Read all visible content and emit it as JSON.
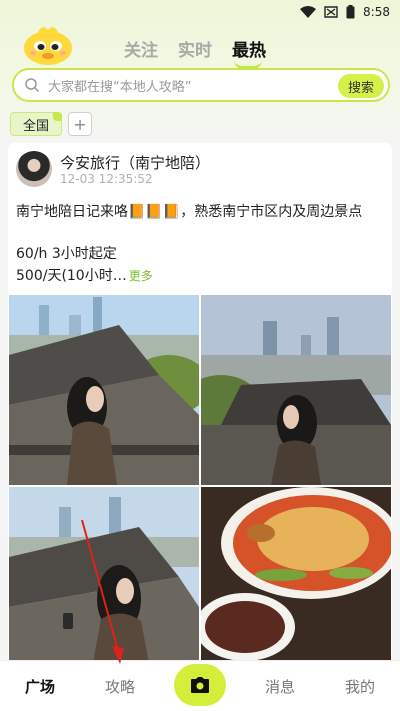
{
  "status_bar": {
    "time": "8:58",
    "icons": [
      "wifi-icon",
      "signal-icon",
      "battery-icon"
    ]
  },
  "header": {
    "tabs": [
      {
        "label": "关注",
        "active": false
      },
      {
        "label": "实时",
        "active": false
      },
      {
        "label": "最热",
        "active": true
      }
    ]
  },
  "search": {
    "placeholder": "大家都在搜“本地人攻略”",
    "button": "搜索"
  },
  "filter": {
    "chip": "全国",
    "add": "+"
  },
  "post": {
    "author": "今安旅行（南宁地陪）",
    "time": "12-03 12:35:52",
    "title": "南宁地陪日记来咯📙📙📙，熟悉南宁市区内及周边景点",
    "line1": "60/h 3小时起定",
    "line2": "500/天(10小时…",
    "more": "更多"
  },
  "bottom_nav": {
    "items": [
      {
        "label": "广场",
        "active": true
      },
      {
        "label": "攻略",
        "active": false
      },
      {
        "label": "消息",
        "active": false
      },
      {
        "label": "我的",
        "active": false
      }
    ],
    "camera_icon": "camera-icon"
  },
  "colors": {
    "accent": "#d4ef3a",
    "more_link": "#7bbf2a"
  }
}
